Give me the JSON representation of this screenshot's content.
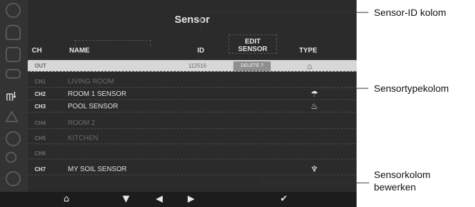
{
  "screen": {
    "title": "Sensor",
    "columns": {
      "ch": "CH",
      "name": "NAME",
      "id": "ID",
      "edit_line1": "EDIT",
      "edit_line2": "SENSOR",
      "type": "TYPE"
    },
    "rows": [
      {
        "ch": "OUT",
        "name": "",
        "id": "112516",
        "action": "DELETE ?",
        "type_icon": "outdoor-sensor-icon",
        "selected": true
      },
      {
        "ch": "CH1",
        "name": "LIVING ROOM",
        "id": "",
        "action": "",
        "type_icon": "",
        "dim": true
      },
      {
        "ch": "CH2",
        "name": "ROOM 1 SENSOR",
        "id": "",
        "action": "",
        "type_icon": "humidity-sensor-icon"
      },
      {
        "ch": "CH3",
        "name": "POOL SENSOR",
        "id": "",
        "action": "",
        "type_icon": "pool-thermometer-icon"
      },
      {
        "ch": "CH4",
        "name": "ROOM 2",
        "id": "",
        "action": "",
        "type_icon": "",
        "dim": true
      },
      {
        "ch": "CH5",
        "name": "KITCHEN",
        "id": "",
        "action": "",
        "type_icon": "",
        "dim": true
      },
      {
        "ch": "CH6",
        "name": "",
        "id": "",
        "action": "",
        "type_icon": "",
        "dim": true
      },
      {
        "ch": "CH7",
        "name": "MY SOIL SENSOR",
        "id": "",
        "action": "",
        "type_icon": "soil-sensor-icon"
      }
    ],
    "sidebar_icons": [
      "clock-icon",
      "alarm-bell-icon",
      "camera-icon",
      "display-icon",
      "sensor-settings-icon",
      "warning-icon",
      "weather-icon",
      "bicycle-icon",
      "pie-chart-icon"
    ],
    "bottom_nav": {
      "home": "⌂",
      "down": "▼",
      "left": "◀",
      "right": "▶",
      "confirm": "✔"
    }
  },
  "callouts": {
    "sensor_id": "Sensor-ID kolom",
    "sensor_type": "Sensortypekolom",
    "edit_line1": "Sensorkolom",
    "edit_line2": "bewerken"
  },
  "colors": {
    "screen_bg": "#2b2b2b",
    "selected_row": "#d7d7d7",
    "text": "#e8e8e8"
  }
}
